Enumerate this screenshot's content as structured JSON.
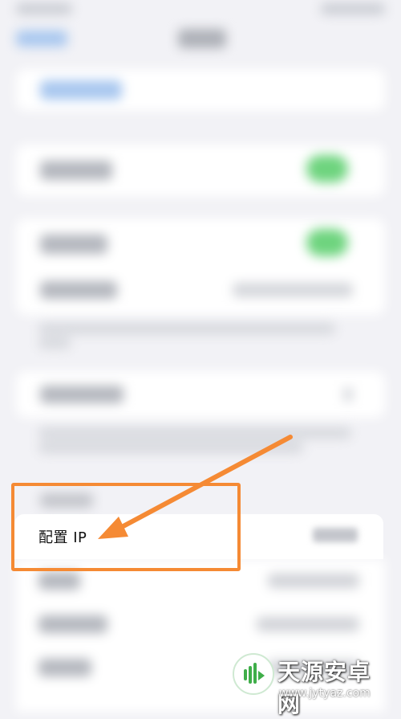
{
  "row": {
    "label": "配置 IP"
  },
  "colors": {
    "highlight": "#f58a34",
    "toggle_on": "#6ed47e",
    "background": "#f2f2f6"
  },
  "watermark": {
    "name": "天源安卓网",
    "url": "www.jytyaz.com"
  }
}
